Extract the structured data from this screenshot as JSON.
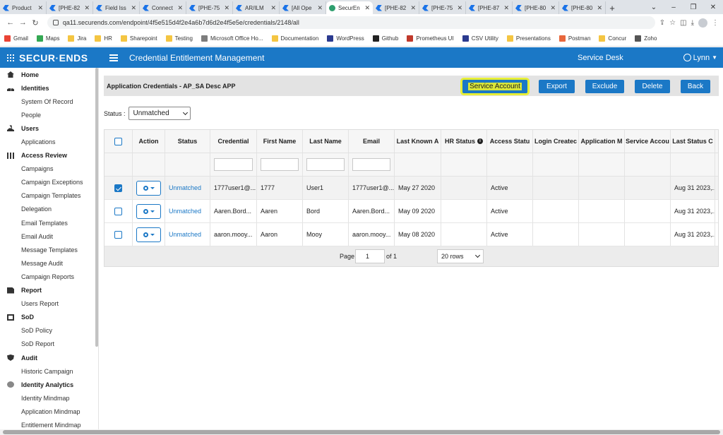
{
  "browser": {
    "tabs": [
      {
        "label": "Product",
        "icon": "blue"
      },
      {
        "label": "[PHE-82",
        "icon": "blue"
      },
      {
        "label": "Field Iss",
        "icon": "blue"
      },
      {
        "label": "Connect",
        "icon": "blue"
      },
      {
        "label": "[PHE-75",
        "icon": "blue"
      },
      {
        "label": "AR/ILM",
        "icon": "blue"
      },
      {
        "label": "[All Ope",
        "icon": "blue"
      },
      {
        "label": "SecurEn",
        "icon": "green",
        "active": true
      },
      {
        "label": "[PHE-82",
        "icon": "blue"
      },
      {
        "label": "[PHE-75",
        "icon": "blue"
      },
      {
        "label": "[PHE-87",
        "icon": "blue"
      },
      {
        "label": "[PHE-80",
        "icon": "blue"
      },
      {
        "label": "[PHE-80",
        "icon": "blue"
      }
    ],
    "url": "qa11.securends.com/endpoint/4f5e515d4f2e4a6b7d6d2e4f5e5e/credentials/2148/all",
    "bookmarks": [
      {
        "label": "Gmail",
        "color": "#ea4335"
      },
      {
        "label": "Maps",
        "color": "#34a853"
      },
      {
        "label": "Jira",
        "color": "#f4c542"
      },
      {
        "label": "HR",
        "color": "#f4c542"
      },
      {
        "label": "Sharepoint",
        "color": "#f4c542"
      },
      {
        "label": "Testing",
        "color": "#f4c542"
      },
      {
        "label": "Microsoft Office Ho...",
        "color": "#7d7d7d"
      },
      {
        "label": "Documentation",
        "color": "#f4c542"
      },
      {
        "label": "WordPress",
        "color": "#2b3a8f"
      },
      {
        "label": "Github",
        "color": "#222222"
      },
      {
        "label": "Prometheus UI",
        "color": "#c0392b"
      },
      {
        "label": "CSV Utility",
        "color": "#2b3a8f"
      },
      {
        "label": "Presentations",
        "color": "#f4c542"
      },
      {
        "label": "Postman",
        "color": "#e8673c"
      },
      {
        "label": "Concur",
        "color": "#f4c542"
      },
      {
        "label": "Zoho",
        "color": "#555555"
      }
    ]
  },
  "header": {
    "logo": "SECUR·ENDS",
    "title": "Credential Entitlement Management",
    "service_desk": "Service Desk",
    "user": "Lynn"
  },
  "sidebar": [
    {
      "type": "section",
      "label": "Home",
      "icon": "home"
    },
    {
      "type": "section",
      "label": "Identities",
      "icon": "ident"
    },
    {
      "type": "item",
      "label": "System Of Record"
    },
    {
      "type": "item",
      "label": "People"
    },
    {
      "type": "section",
      "label": "Users",
      "icon": "user"
    },
    {
      "type": "item",
      "label": "Applications"
    },
    {
      "type": "section",
      "label": "Access Review",
      "icon": "grid"
    },
    {
      "type": "item",
      "label": "Campaigns"
    },
    {
      "type": "item",
      "label": "Campaign Exceptions"
    },
    {
      "type": "item",
      "label": "Campaign Templates"
    },
    {
      "type": "item",
      "label": "Delegation"
    },
    {
      "type": "item",
      "label": "Email Templates"
    },
    {
      "type": "item",
      "label": "Email Audit"
    },
    {
      "type": "item",
      "label": "Message Templates"
    },
    {
      "type": "item",
      "label": "Message Audit"
    },
    {
      "type": "item",
      "label": "Campaign Reports"
    },
    {
      "type": "section",
      "label": "Report",
      "icon": "doc"
    },
    {
      "type": "item",
      "label": "Users Report"
    },
    {
      "type": "section",
      "label": "SoD",
      "icon": "sod"
    },
    {
      "type": "item",
      "label": "SoD Policy"
    },
    {
      "type": "item",
      "label": "SoD Report"
    },
    {
      "type": "section",
      "label": "Audit",
      "icon": "shield"
    },
    {
      "type": "item",
      "label": "Historic Campaign"
    },
    {
      "type": "section",
      "label": "Identity Analytics",
      "icon": "analytics"
    },
    {
      "type": "item",
      "label": "Identity Mindmap"
    },
    {
      "type": "item",
      "label": "Application Mindmap"
    },
    {
      "type": "item",
      "label": "Entitlement Mindmap"
    }
  ],
  "panel": {
    "title": "Application Credentials - AP_SA Desc APP",
    "buttons": {
      "service_account": "Service Account",
      "export": "Export",
      "exclude": "Exclude",
      "delete": "Delete",
      "back": "Back"
    },
    "highlight_color": "#e8ef36"
  },
  "status_filter": {
    "label": "Status :",
    "value": "Unmatched"
  },
  "table": {
    "columns": [
      "",
      "Action",
      "Status",
      "Credential",
      "First Name",
      "Last Name",
      "Email",
      "Last Known A",
      "HR Status",
      "Access Statu",
      "Login Createc",
      "Application M",
      "Service Accou",
      "Last Status C"
    ],
    "rows": [
      {
        "checked": true,
        "status": "Unmatched",
        "credential": "1777user1@...",
        "first": "1777",
        "last": "User1",
        "email": "1777user1@...",
        "last_known": "May 27 2020",
        "hr": "",
        "access": "Active",
        "login": "",
        "app_m": "",
        "svc": "",
        "last_status": "Aug 31 2023,..."
      },
      {
        "checked": false,
        "status": "Unmatched",
        "credential": "Aaren.Bord...",
        "first": "Aaren",
        "last": "Bord",
        "email": "Aaren.Bord...",
        "last_known": "May 09 2020",
        "hr": "",
        "access": "Active",
        "login": "",
        "app_m": "",
        "svc": "",
        "last_status": "Aug 31 2023,..."
      },
      {
        "checked": false,
        "status": "Unmatched",
        "credential": "aaron.mooy...",
        "first": "Aaron",
        "last": "Mooy",
        "email": "aaron.mooy...",
        "last_known": "May 08 2020",
        "hr": "",
        "access": "Active",
        "login": "",
        "app_m": "",
        "svc": "",
        "last_status": "Aug 31 2023,..."
      }
    ]
  },
  "pager": {
    "page_label": "Page",
    "page_value": "1",
    "of_label": "of 1",
    "rows_value": "20 rows"
  }
}
